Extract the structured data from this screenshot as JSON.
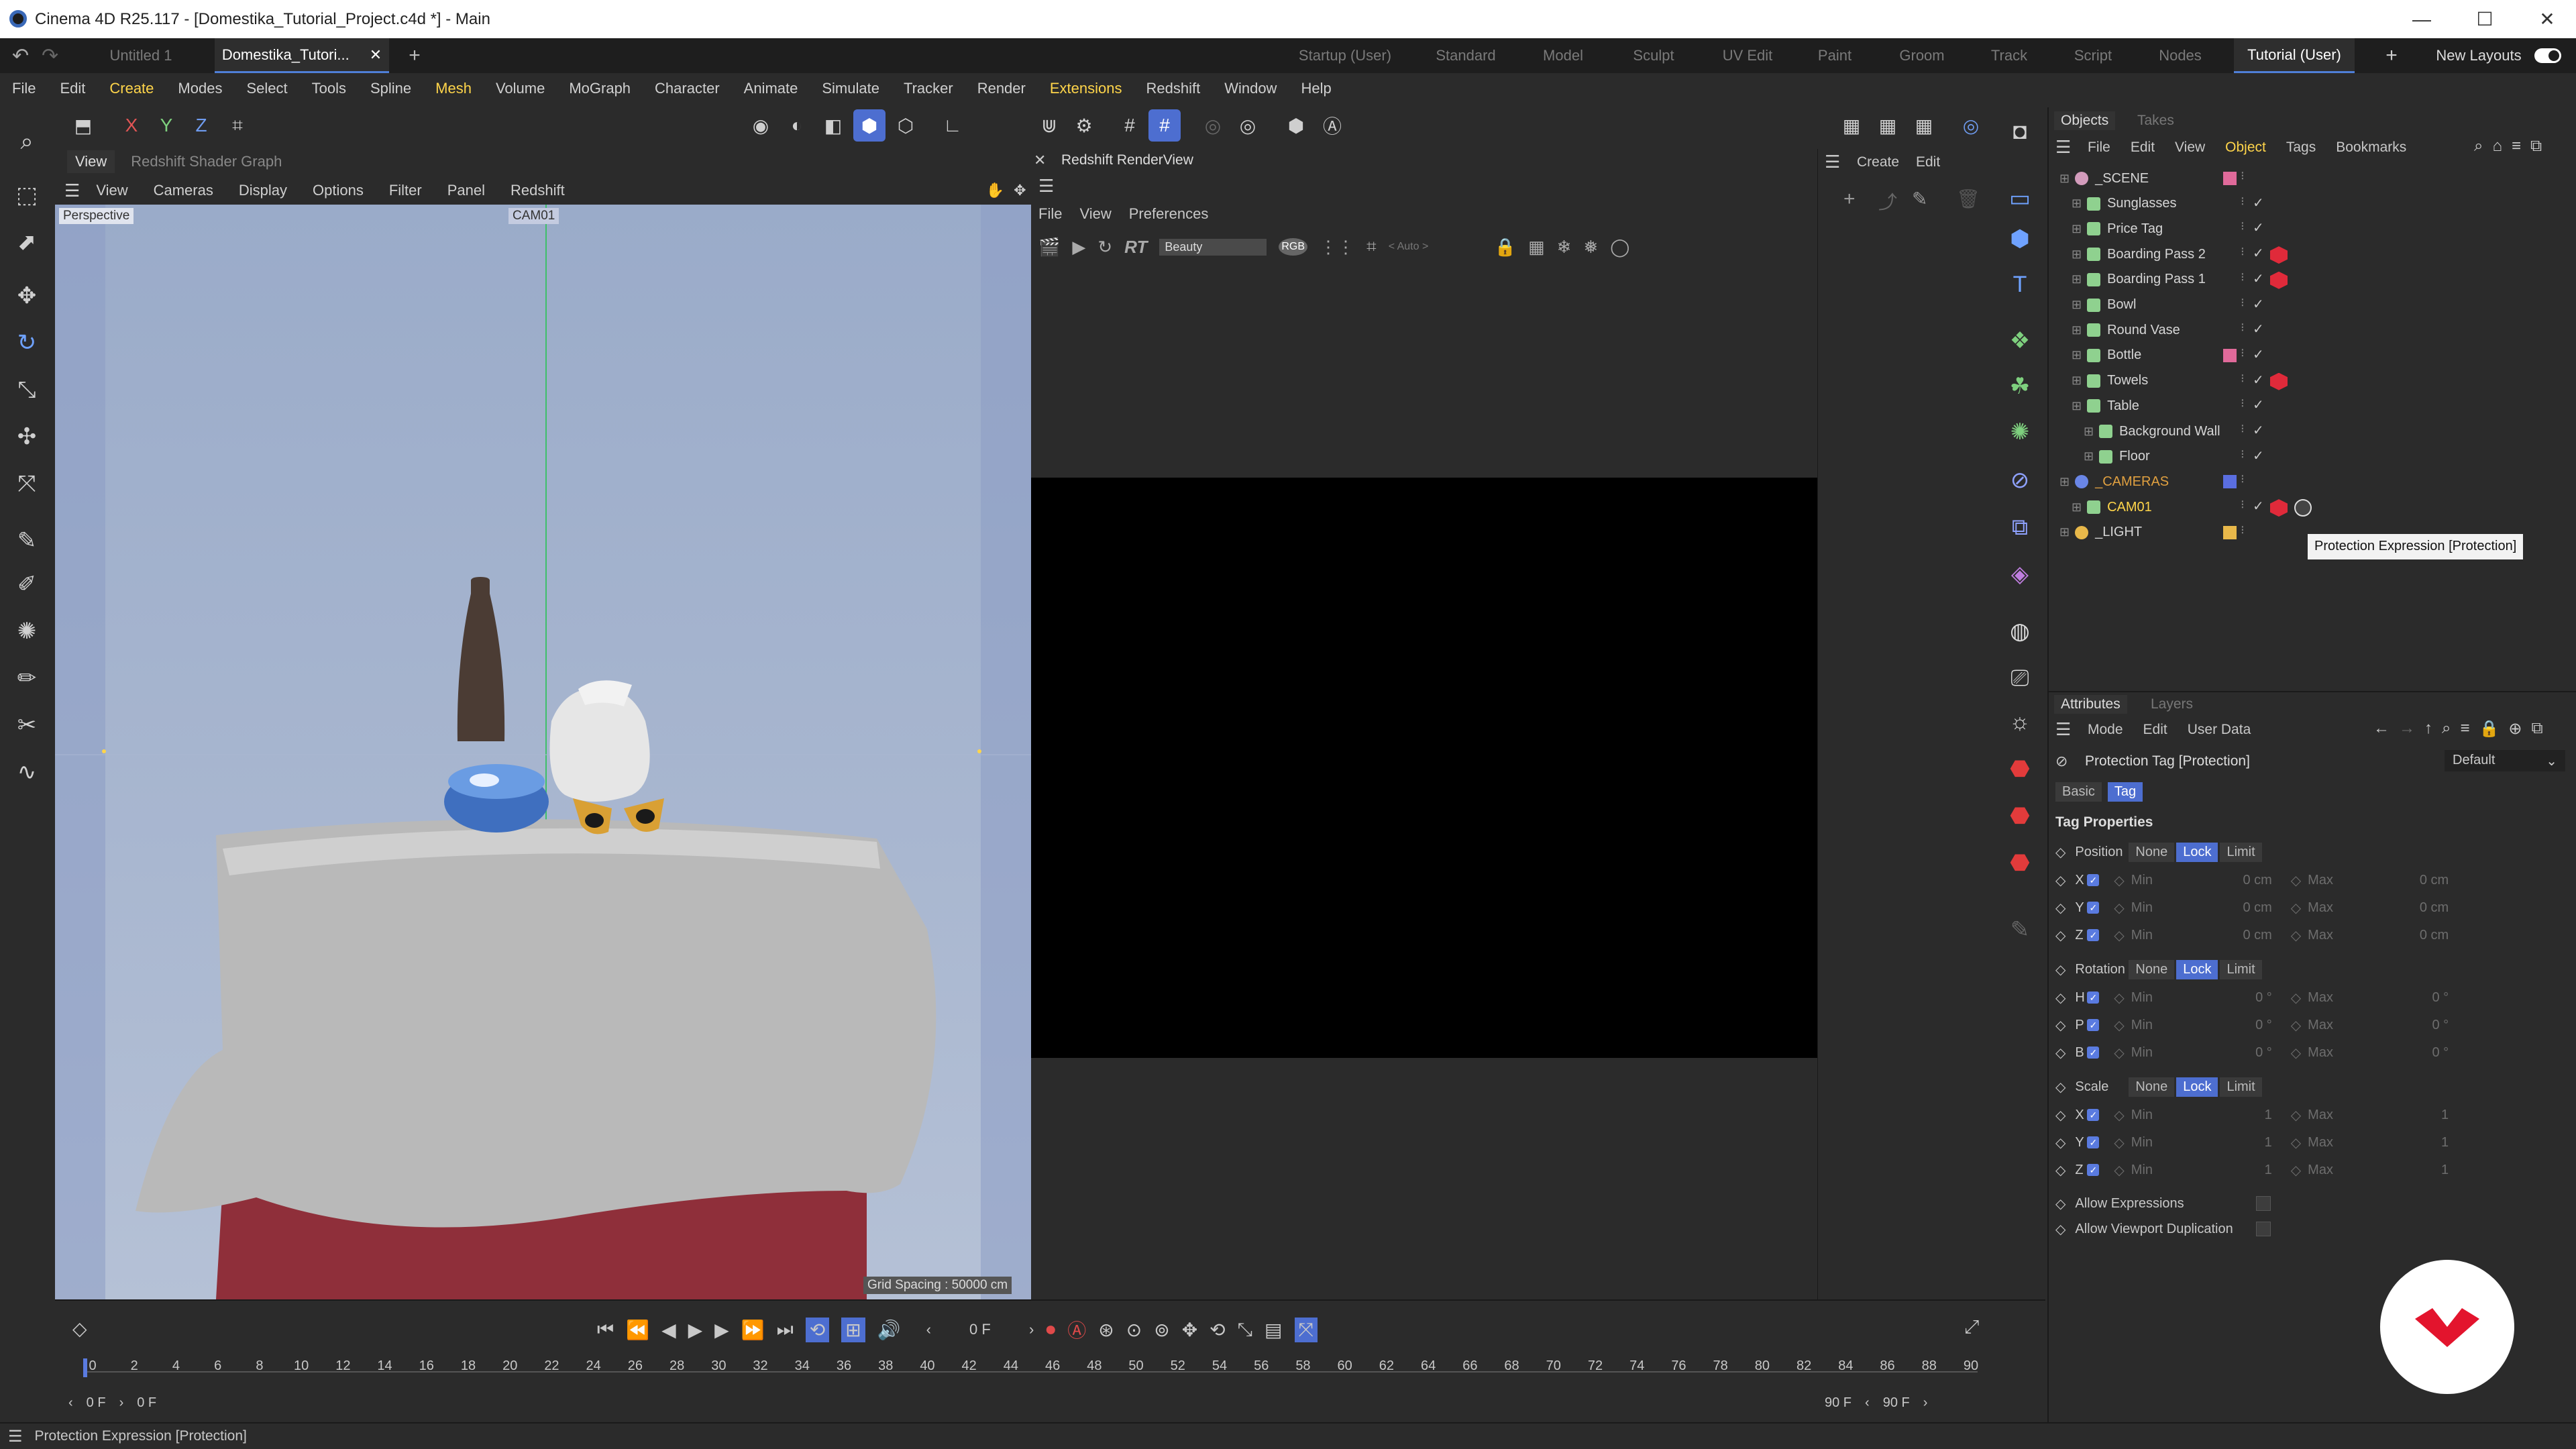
{
  "titlebar": {
    "title": "Cinema 4D R25.117 - [Domestika_Tutorial_Project.c4d *] - Main",
    "min": "—",
    "max": "☐",
    "close": "✕"
  },
  "doc_tabs": [
    {
      "label": "Untitled 1"
    },
    {
      "label": "Domestika_Tutori..."
    }
  ],
  "layout_tabs": [
    "Startup (User)",
    "Standard",
    "Model",
    "Sculpt",
    "UV Edit",
    "Paint",
    "Groom",
    "Track",
    "Script",
    "Nodes",
    "Tutorial (User)"
  ],
  "new_layouts": "New Layouts",
  "menus": [
    "File",
    "Edit",
    "Create",
    "Modes",
    "Select",
    "Tools",
    "Spline",
    "Mesh",
    "Volume",
    "MoGraph",
    "Character",
    "Animate",
    "Simulate",
    "Tracker",
    "Render",
    "Extensions",
    "Redshift",
    "Window",
    "Help"
  ],
  "viewport": {
    "tabs": [
      "View",
      "Redshift Shader Graph"
    ],
    "menu": [
      "View",
      "Cameras",
      "Display",
      "Options",
      "Filter",
      "Panel",
      "Redshift"
    ],
    "label": "Perspective",
    "camera": "CAM01",
    "grid": "Grid Spacing : 50000 cm"
  },
  "renderview": {
    "title": "Redshift RenderView",
    "menu": [
      "File",
      "View",
      "Preferences"
    ],
    "aov": "Beauty",
    "rgb": "RGB",
    "rt": "RT",
    "auto": "< Auto >"
  },
  "create_panel": {
    "menu": [
      "Create",
      "Edit"
    ]
  },
  "objects": {
    "tabs": [
      "Objects",
      "Takes"
    ],
    "menu": [
      "File",
      "Edit",
      "View",
      "Object",
      "Tags",
      "Bookmarks"
    ],
    "rows": [
      {
        "name": "_SCENE",
        "color": "#e06a9a"
      },
      {
        "name": "Sunglasses",
        "color": ""
      },
      {
        "name": "Price Tag",
        "color": ""
      },
      {
        "name": "Boarding Pass 2",
        "color": ""
      },
      {
        "name": "Boarding Pass 1",
        "color": ""
      },
      {
        "name": "Bowl",
        "color": ""
      },
      {
        "name": "Round Vase",
        "color": ""
      },
      {
        "name": "Bottle",
        "color": "#e06a9a"
      },
      {
        "name": "Towels",
        "color": ""
      },
      {
        "name": "Table",
        "color": ""
      },
      {
        "name": "Background Wall",
        "color": ""
      },
      {
        "name": "Floor",
        "color": ""
      },
      {
        "name": "_CAMERAS",
        "color": "#5a6ee0"
      },
      {
        "name": "CAM01",
        "color": ""
      },
      {
        "name": "_LIGHT",
        "color": "#e8b84a"
      }
    ]
  },
  "tooltip": "Protection Expression [Protection]",
  "attributes": {
    "tabs": [
      "Attributes",
      "Layers"
    ],
    "menu": [
      "Mode",
      "Edit",
      "User Data"
    ],
    "title": "Protection Tag [Protection]",
    "preset": "Default",
    "subtabs": [
      "Basic",
      "Tag"
    ],
    "section": "Tag Properties",
    "groups": [
      {
        "label": "Position",
        "modes": [
          "None",
          "Lock",
          "Limit"
        ],
        "axes": [
          {
            "a": "X",
            "min": "0 cm",
            "max": "0 cm"
          },
          {
            "a": "Y",
            "min": "0 cm",
            "max": "0 cm"
          },
          {
            "a": "Z",
            "min": "0 cm",
            "max": "0 cm"
          }
        ]
      },
      {
        "label": "Rotation",
        "modes": [
          "None",
          "Lock",
          "Limit"
        ],
        "axes": [
          {
            "a": "H",
            "min": "0 °",
            "max": "0 °"
          },
          {
            "a": "P",
            "min": "0 °",
            "max": "0 °"
          },
          {
            "a": "B",
            "min": "0 °",
            "max": "0 °"
          }
        ]
      },
      {
        "label": "Scale",
        "modes": [
          "None",
          "Lock",
          "Limit"
        ],
        "axes": [
          {
            "a": "X",
            "min": "1",
            "max": "1"
          },
          {
            "a": "Y",
            "min": "1",
            "max": "1"
          },
          {
            "a": "Z",
            "min": "1",
            "max": "1"
          }
        ]
      }
    ],
    "min_label": "Min",
    "max_label": "Max",
    "allow_expressions": "Allow Expressions",
    "allow_viewport_dup": "Allow Viewport Duplication"
  },
  "timeline": {
    "frame": "0 F",
    "start": "0 F",
    "start2": "0 F",
    "end": "90 F",
    "end2": "90 F",
    "ticks": [
      "0",
      "2",
      "4",
      "6",
      "8",
      "10",
      "12",
      "14",
      "16",
      "18",
      "20",
      "22",
      "24",
      "26",
      "28",
      "30",
      "32",
      "34",
      "36",
      "38",
      "40",
      "42",
      "44",
      "46",
      "48",
      "50",
      "52",
      "54",
      "56",
      "58",
      "60",
      "62",
      "64",
      "66",
      "68",
      "70",
      "72",
      "74",
      "76",
      "78",
      "80",
      "82",
      "84",
      "86",
      "88",
      "90"
    ]
  },
  "status": "Protection Expression [Protection]"
}
